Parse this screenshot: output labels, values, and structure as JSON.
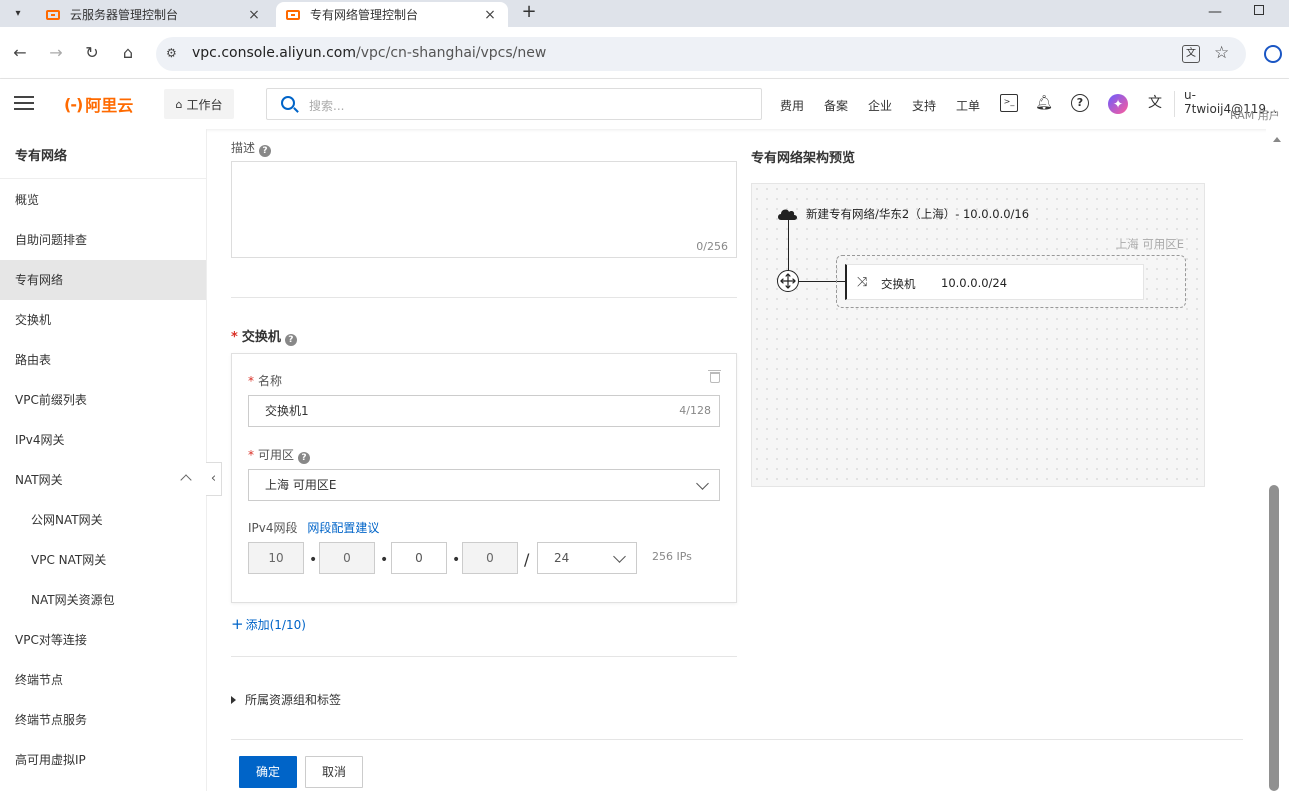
{
  "browser": {
    "tabs": [
      {
        "title": "云服务器管理控制台",
        "active": false
      },
      {
        "title": "专有网络管理控制台",
        "active": true
      }
    ],
    "url_host": "vpc.console.aliyun.com",
    "url_path": "/vpc/cn-shanghai/vpcs/new"
  },
  "header": {
    "logo_text": "阿里云",
    "logo_mark": "(-)",
    "workbench_label": "工作台",
    "search_placeholder": "搜索...",
    "links": [
      "费用",
      "备案",
      "企业",
      "支持",
      "工单"
    ],
    "user_name": "u-7twioij4@119...",
    "user_role": "RAM 用户"
  },
  "sidebar": {
    "title": "专有网络",
    "items": [
      {
        "label": "概览"
      },
      {
        "label": "自助问题排查"
      },
      {
        "label": "专有网络",
        "active": true
      },
      {
        "label": "交换机"
      },
      {
        "label": "路由表"
      },
      {
        "label": "VPC前缀列表"
      },
      {
        "label": "IPv4网关"
      },
      {
        "label": "NAT网关",
        "expanded": true
      },
      {
        "label": "公网NAT网关",
        "sub": true
      },
      {
        "label": "VPC NAT网关",
        "sub": true
      },
      {
        "label": "NAT网关资源包",
        "sub": true
      },
      {
        "label": "VPC对等连接"
      },
      {
        "label": "终端节点"
      },
      {
        "label": "终端节点服务"
      },
      {
        "label": "高可用虚拟IP"
      }
    ]
  },
  "form": {
    "description_label": "描述",
    "description_counter": "0/256",
    "switch_section_title": "交换机",
    "switch": {
      "name_label": "名称",
      "name_value": "交换机1",
      "name_counter": "4/128",
      "zone_label": "可用区",
      "zone_value": "上海 可用区E",
      "ipv4_label": "IPv4网段",
      "ipv4_suggest_link": "网段配置建议",
      "ip_octets": [
        "10",
        "0",
        "0",
        "0"
      ],
      "mask": "24",
      "ip_count": "256 IPs"
    },
    "add_label": "添加(1/10)",
    "resource_group_label": "所属资源组和标签",
    "confirm_label": "确定",
    "cancel_label": "取消"
  },
  "preview": {
    "title": "专有网络架构预览",
    "vpc_label": "新建专有网络/华东2（上海）- 10.0.0.0/16",
    "zone_label": "上海 可用区E",
    "switch_name": "交换机",
    "switch_cidr": "10.0.0.0/24"
  }
}
